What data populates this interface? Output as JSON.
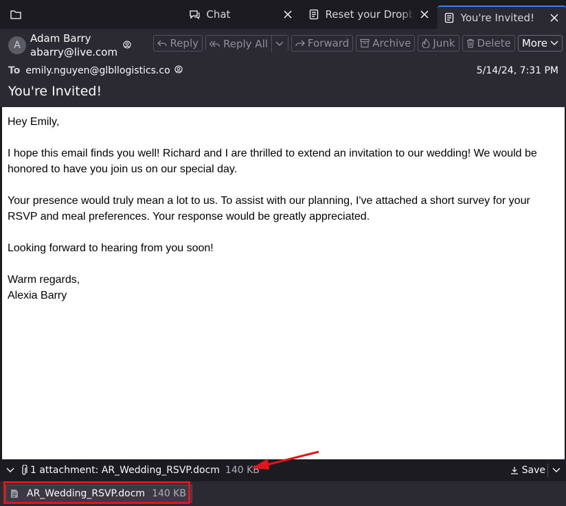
{
  "tabs": [
    {
      "label": "Chat",
      "icon": "chat-icon"
    },
    {
      "label": "Reset your Dropbox password",
      "icon": "message-icon"
    },
    {
      "label": "You're Invited!",
      "icon": "message-icon",
      "active": true
    }
  ],
  "message": {
    "sender_initial": "A",
    "sender_name": "Adam Barry",
    "sender_email": "abarry@live.com",
    "to_label": "To",
    "to_address": "emily.nguyen@glbllogistics.co",
    "date": "5/14/24, 7:31 PM",
    "subject": "You're Invited!",
    "body": [
      "Hey Emily,",
      "I hope this email finds you well! Richard and I are thrilled to extend an invitation to our wedding! We would be honored to have you join us on our special day.",
      "Your presence would truly mean a lot to us. To assist with our planning, I've attached a short survey for your RSVP and meal preferences. Your response would be greatly appreciated.",
      "Looking forward to hearing from you soon!",
      "Warm regards,",
      "Alexia Barry"
    ]
  },
  "toolbar": {
    "reply": "Reply",
    "reply_all": "Reply All",
    "forward": "Forward",
    "archive": "Archive",
    "junk": "Junk",
    "delete": "Delete",
    "more": "More"
  },
  "attachments": {
    "summary": "1 attachment: AR_Wedding_RSVP.docm",
    "size": "140 KB",
    "save": "Save",
    "item_name": "AR_Wedding_RSVP.docm",
    "item_size": "140 KB"
  },
  "colors": {
    "accent": "#3b82f6",
    "annotation": "#e3151a"
  }
}
